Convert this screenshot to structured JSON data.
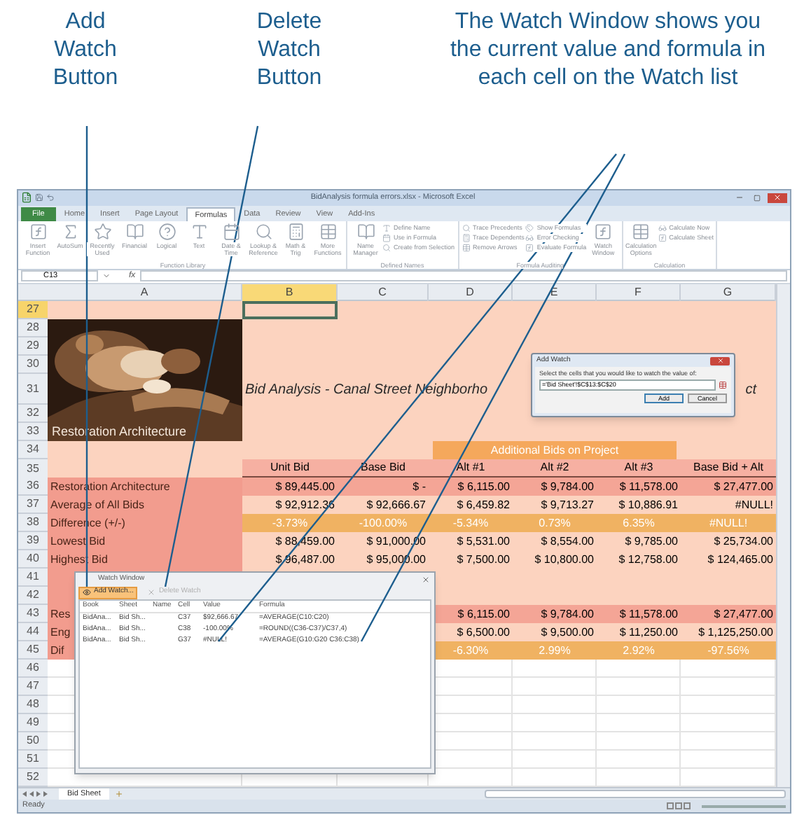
{
  "callouts": [
    {
      "text": "Add Watch Button"
    },
    {
      "text": "Delete Watch Button"
    },
    {
      "text": "The Watch Window shows you the current value and formula in each cell on the Watch list"
    }
  ],
  "window": {
    "title": "BidAnalysis formula errors.xlsx - Microsoft Excel"
  },
  "ribbon_tabs": [
    {
      "label": "File",
      "selected": false,
      "kind": "file"
    },
    {
      "label": "Home",
      "selected": false,
      "kind": "tab"
    },
    {
      "label": "Insert",
      "selected": false,
      "kind": "tab"
    },
    {
      "label": "Page Layout",
      "selected": false,
      "kind": "tab"
    },
    {
      "label": "Formulas",
      "selected": true,
      "kind": "tab"
    },
    {
      "label": "Data",
      "selected": false,
      "kind": "tab"
    },
    {
      "label": "Review",
      "selected": false,
      "kind": "tab"
    },
    {
      "label": "View",
      "selected": false,
      "kind": "tab"
    },
    {
      "label": "Add-Ins",
      "selected": false,
      "kind": "tab"
    }
  ],
  "ribbon_groups": [
    {
      "label": "Function Library",
      "items": [
        {
          "label": "Insert Function",
          "kind": "large"
        },
        {
          "label": "AutoSum",
          "kind": "large"
        },
        {
          "label": "Recently Used",
          "kind": "large"
        },
        {
          "label": "Financial",
          "kind": "large"
        },
        {
          "label": "Logical",
          "kind": "large"
        },
        {
          "label": "Text",
          "kind": "large"
        },
        {
          "label": "Date & Time",
          "kind": "large"
        },
        {
          "label": "Lookup & Reference",
          "kind": "large"
        },
        {
          "label": "Math & Trig",
          "kind": "large"
        },
        {
          "label": "More Functions",
          "kind": "large"
        }
      ]
    },
    {
      "label": "Defined Names",
      "items": [
        {
          "label": "Name Manager",
          "kind": "large"
        },
        {
          "label": "Define Name",
          "kind": "small"
        },
        {
          "label": "Use in Formula",
          "kind": "small"
        },
        {
          "label": "Create from Selection",
          "kind": "small"
        }
      ]
    },
    {
      "label": "Formula Auditing",
      "items": [
        {
          "label": "Trace Precedents",
          "kind": "small"
        },
        {
          "label": "Trace Dependents",
          "kind": "small"
        },
        {
          "label": "Remove Arrows",
          "kind": "small"
        },
        {
          "label": "Show Formulas",
          "kind": "small"
        },
        {
          "label": "Error Checking",
          "kind": "small"
        },
        {
          "label": "Evaluate Formula",
          "kind": "small"
        },
        {
          "label": "Watch Window",
          "kind": "large"
        }
      ]
    },
    {
      "label": "Calculation",
      "items": [
        {
          "label": "Calculation Options",
          "kind": "large"
        },
        {
          "label": "Calculate Now",
          "kind": "small"
        },
        {
          "label": "Calculate Sheet",
          "kind": "small"
        }
      ]
    }
  ],
  "formula_bar": {
    "name_box": "C13",
    "function_label": "fx"
  },
  "columns": [
    {
      "label": "A",
      "selected": false
    },
    {
      "label": "B",
      "selected": true
    },
    {
      "label": "C",
      "selected": false
    },
    {
      "label": "D",
      "selected": false
    },
    {
      "label": "E",
      "selected": false
    },
    {
      "label": "F",
      "selected": false
    },
    {
      "label": "G",
      "selected": false
    }
  ],
  "sheet": {
    "title_left": "Bid Analysis - Canal Street Neighborho",
    "title_right": "ct",
    "picture_caption": "Restoration Architecture",
    "band_label": "Additional Bids on Project"
  },
  "rows": [
    {
      "number": "27",
      "selected": true,
      "kind": "top"
    },
    {
      "number": "28",
      "selected": false,
      "kind": "top"
    },
    {
      "number": "29",
      "selected": false,
      "kind": "top"
    },
    {
      "number": "30",
      "selected": false,
      "kind": "top"
    },
    {
      "number": "31",
      "selected": false,
      "kind": "title"
    },
    {
      "number": "32",
      "selected": false,
      "kind": "top"
    },
    {
      "number": "33",
      "selected": false,
      "kind": "top"
    },
    {
      "number": "34",
      "selected": false,
      "kind": "band"
    },
    {
      "number": "35",
      "selected": false,
      "kind": "header",
      "cells": [
        null,
        "Unit Bid",
        "Base Bid",
        "Alt #1",
        "Alt #2",
        "Alt #3",
        "Base Bid + Alt"
      ]
    },
    {
      "number": "36",
      "selected": false,
      "kind": "salmon",
      "cells": [
        "Restoration Architecture",
        "$ 89,445.00",
        "$ -",
        "$ 6,115.00",
        "$ 9,784.00",
        "$ 11,578.00",
        "$ 27,477.00"
      ]
    },
    {
      "number": "37",
      "selected": false,
      "kind": "light",
      "cells": [
        "Average of All Bids",
        "$ 92,912.36",
        "$ 92,666.67",
        "$ 6,459.82",
        "$ 9,713.27",
        "$ 10,886.91",
        "#NULL!"
      ]
    },
    {
      "number": "38",
      "selected": false,
      "kind": "orange",
      "cells": [
        "Difference (+/-)",
        "-3.73%",
        "-100.00%",
        "-5.34%",
        "0.73%",
        "6.35%",
        "#NULL!"
      ]
    },
    {
      "number": "39",
      "selected": false,
      "kind": "light",
      "cells": [
        "Lowest Bid",
        "$ 88,459.00",
        "$ 91,000.00",
        "$ 5,531.00",
        "$ 8,554.00",
        "$ 9,785.00",
        "$ 25,734.00"
      ]
    },
    {
      "number": "40",
      "selected": false,
      "kind": "light",
      "cells": [
        "Highest Bid",
        "$ 96,487.00",
        "$ 95,000.00",
        "$ 7,500.00",
        "$ 10,800.00",
        "$ 12,758.00",
        "$ 124,465.00"
      ]
    },
    {
      "number": "41",
      "selected": false,
      "kind": "gap"
    },
    {
      "number": "42",
      "selected": false,
      "kind": "gap"
    },
    {
      "number": "43",
      "selected": false,
      "kind": "salmon",
      "cells": [
        "Res",
        null,
        null,
        "$ 6,115.00",
        "$ 9,784.00",
        "$ 11,578.00",
        "$ 27,477.00"
      ]
    },
    {
      "number": "44",
      "selected": false,
      "kind": "light",
      "cells": [
        "Eng",
        null,
        null,
        "$ 6,500.00",
        "$ 9,500.00",
        "$ 11,250.00",
        "$ 1,125,250.00"
      ]
    },
    {
      "number": "45",
      "selected": false,
      "kind": "orange",
      "cells": [
        "Dif",
        null,
        null,
        "-6.30%",
        "2.99%",
        "2.92%",
        "-97.56%"
      ]
    },
    {
      "number": "46",
      "selected": false,
      "kind": "blank"
    },
    {
      "number": "47",
      "selected": false,
      "kind": "blank"
    },
    {
      "number": "48",
      "selected": false,
      "kind": "blank"
    },
    {
      "number": "49",
      "selected": false,
      "kind": "blank"
    },
    {
      "number": "50",
      "selected": false,
      "kind": "blank"
    },
    {
      "number": "51",
      "selected": false,
      "kind": "blank"
    },
    {
      "number": "52",
      "selected": false,
      "kind": "blank"
    }
  ],
  "add_watch_dialog": {
    "title": "Add Watch",
    "prompt": "Select the cells that you would like to watch the value of:",
    "value": "='Bid Sheet'!$C$13:$C$20",
    "buttons": [
      {
        "label": "Add",
        "kind": "default"
      },
      {
        "label": "Cancel",
        "kind": "normal"
      }
    ]
  },
  "watch_window": {
    "title": "Watch Window",
    "toolbar": [
      {
        "label": "Add Watch...",
        "kind": "add",
        "highlighted": true,
        "disabled": false
      },
      {
        "label": "Delete Watch",
        "kind": "delete",
        "highlighted": false,
        "disabled": true
      }
    ],
    "columns": [
      "Book",
      "Sheet",
      "Name",
      "Cell",
      "Value",
      "Formula"
    ],
    "rows": [
      {
        "cells": [
          "BidAna...",
          "Bid Sh...",
          null,
          "C37",
          "$92,666.67",
          "=AVERAGE(C10:C20)"
        ]
      },
      {
        "cells": [
          "BidAna...",
          "Bid Sh...",
          null,
          "C38",
          "-100.00%",
          "=ROUND((C36-C37)/C37,4)"
        ]
      },
      {
        "cells": [
          "BidAna...",
          "Bid Sh...",
          null,
          "G37",
          "#NULL!",
          "=AVERAGE(G10:G20 C36:C38)"
        ]
      }
    ]
  },
  "sheet_tabs": [
    {
      "label": "Bid Sheet",
      "selected": true
    }
  ],
  "status_bar": {
    "text": "Ready"
  }
}
